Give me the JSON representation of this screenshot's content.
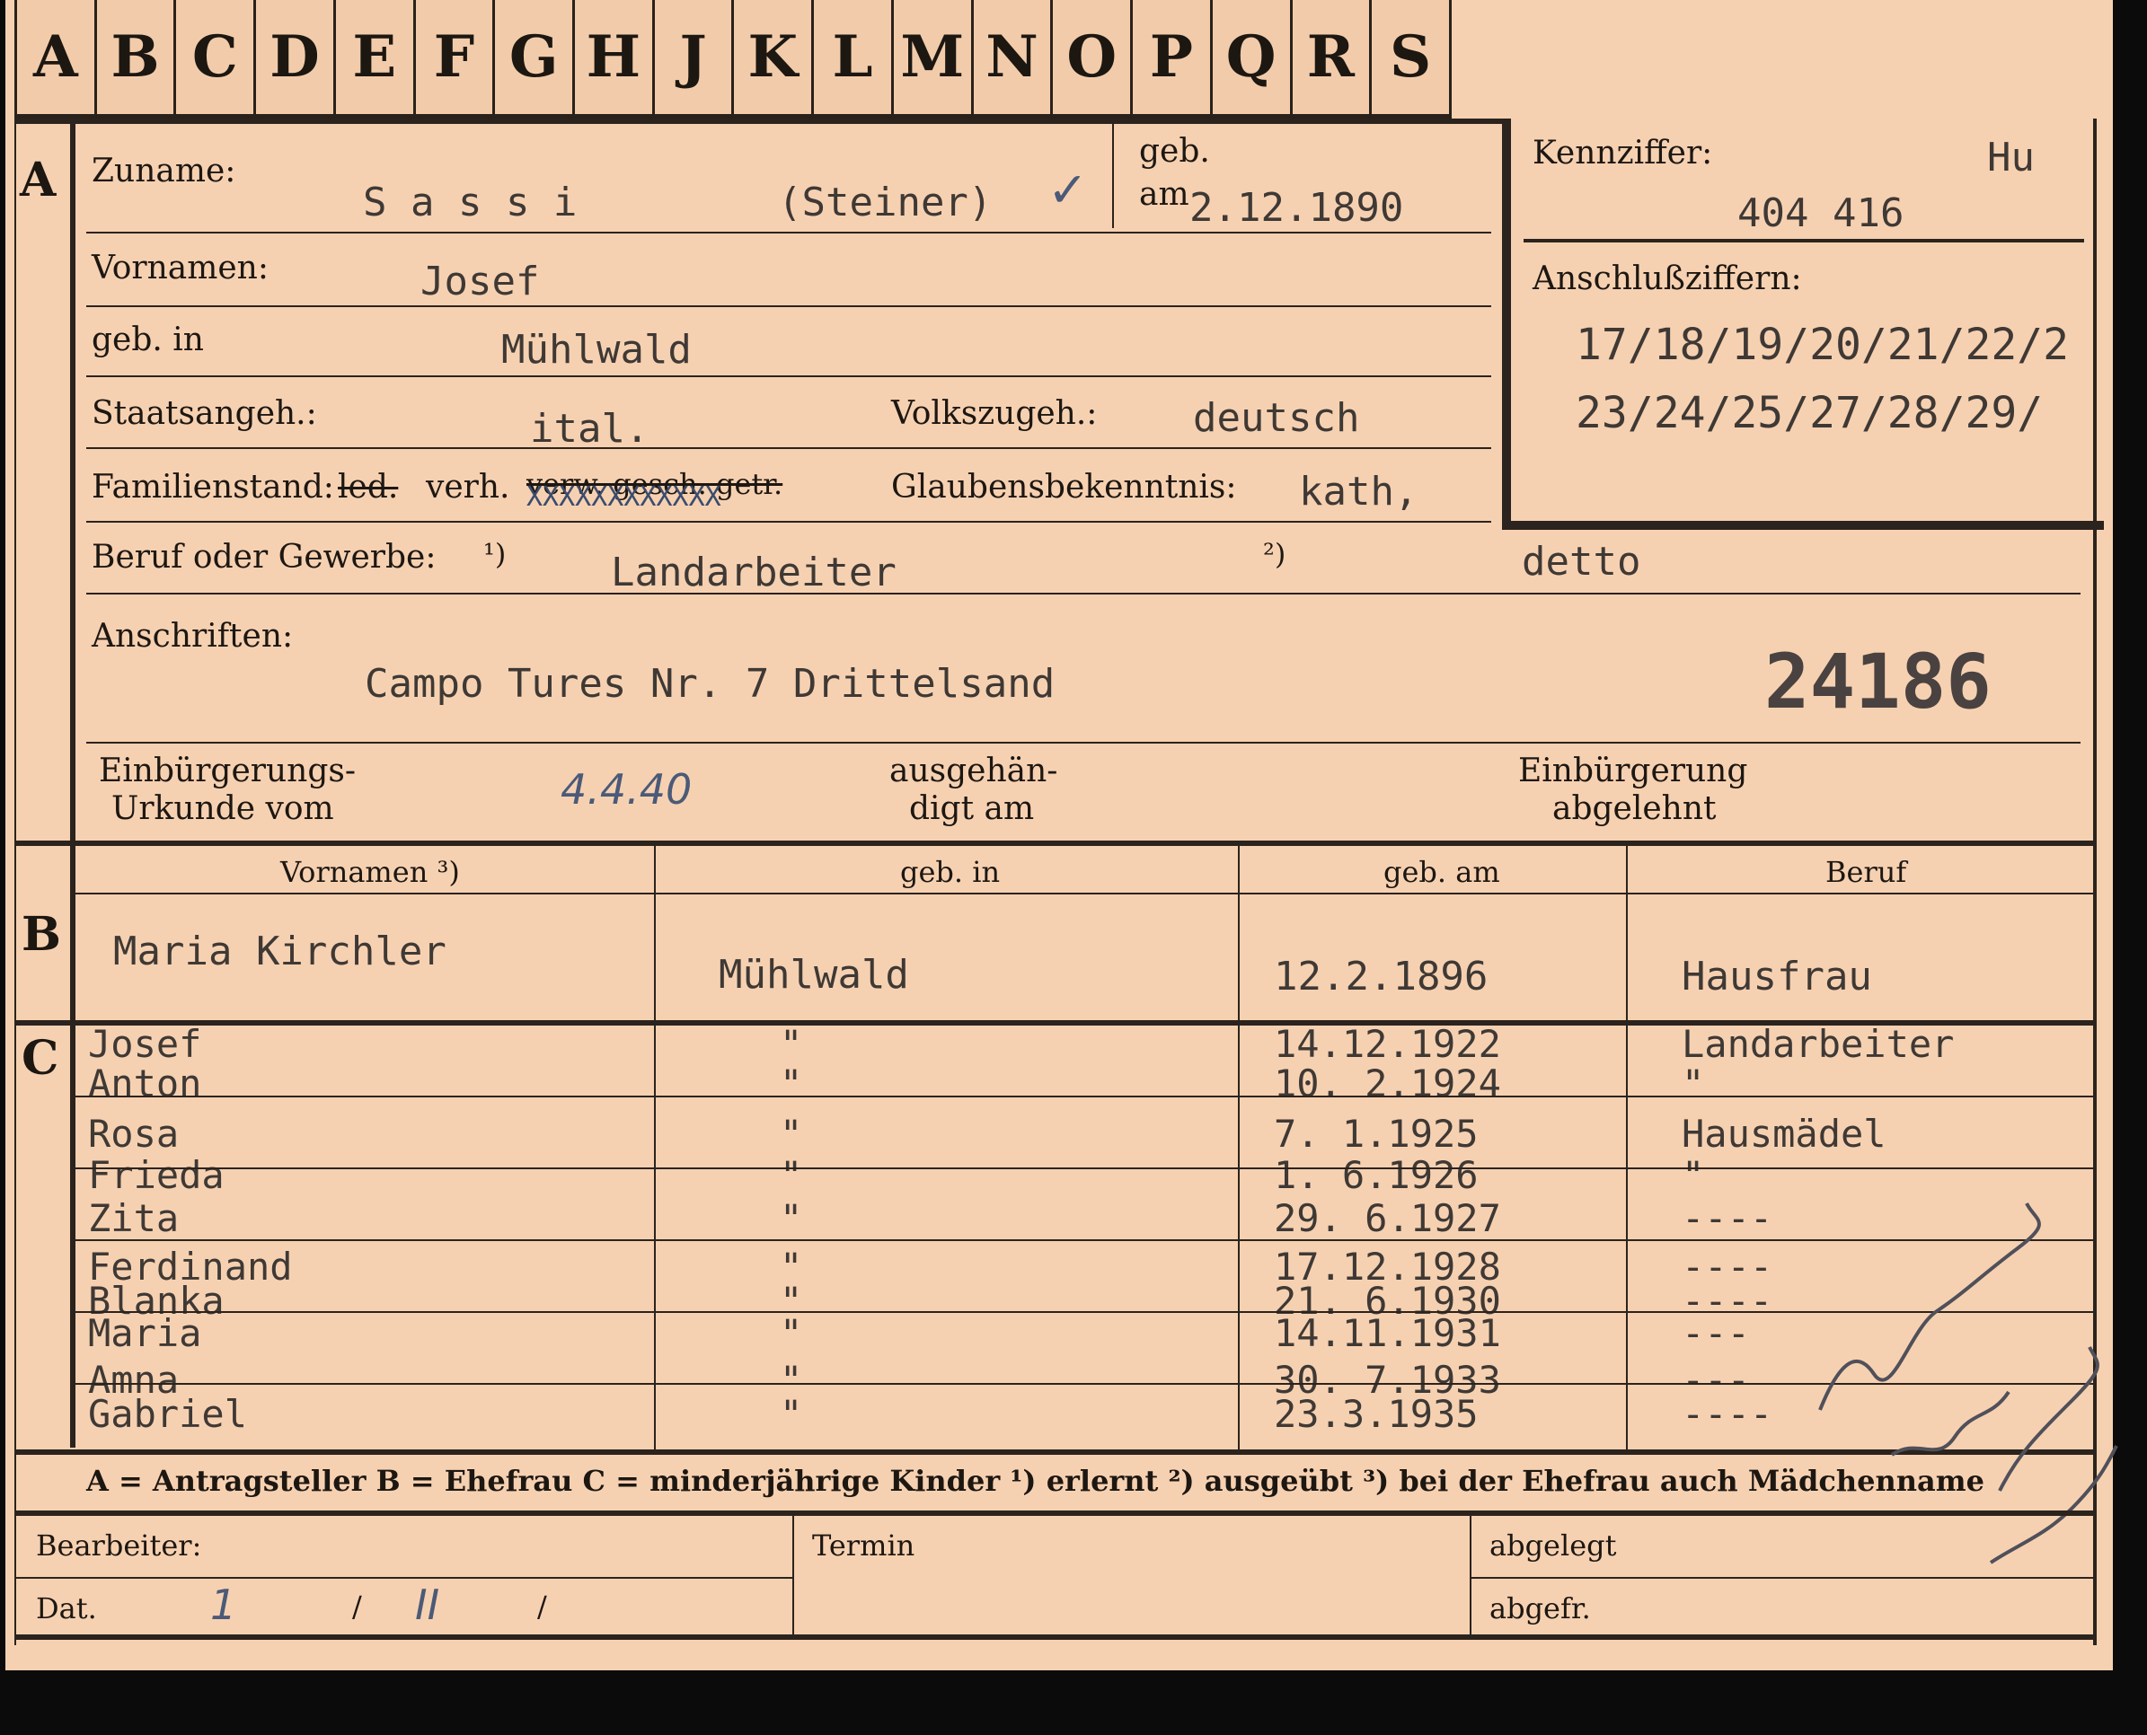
{
  "alphabet": [
    "A",
    "B",
    "C",
    "D",
    "E",
    "F",
    "G",
    "H",
    "J",
    "K",
    "L",
    "M",
    "N",
    "O",
    "P",
    "Q",
    "R",
    "S"
  ],
  "labels": {
    "sec_a": "A",
    "sec_b": "B",
    "sec_c": "C",
    "zuname": "Zuname:",
    "geb": "geb.",
    "am": "am",
    "kennziffer": "Kennziffer:",
    "anschluss": "Anschlußziffern:",
    "vornamen": "Vornamen:",
    "geb_in": "geb. in",
    "staats": "Staatsangeh.:",
    "volks": "Volkszugeh.:",
    "familien": "Familienstand:",
    "glauben": "Glaubensbekenntnis:",
    "beruf": "Beruf oder Gewerbe:",
    "sup1": "¹)",
    "sup2": "²)",
    "anschriften": "Anschriften:",
    "einb_urk_1": "Einbürgerungs-",
    "einb_urk_2": "Urkunde vom",
    "ausgeh_1": "ausgehän-",
    "ausgeh_2": "digt am",
    "einb_abg_1": "Einbürgerung",
    "einb_abg_2": "abgelehnt",
    "col_vornamen": "Vornamen ³)",
    "col_gebin": "geb. in",
    "col_gebam": "geb. am",
    "col_beruf": "Beruf",
    "legend": "A = Antragsteller   B = Ehefrau   C = minderjährige Kinder   ¹) erlernt   ²) ausgeübt   ³) bei der Ehefrau auch Mädchenname",
    "bearbeiter": "Bearbeiter:",
    "termin": "Termin",
    "abgelegt": "abgelegt",
    "dat": "Dat.",
    "abgefr": "abgefr."
  },
  "applicant": {
    "surname": "S a s s i",
    "surname_alt": "(Steiner)",
    "check_mark": "✓",
    "birth_date": "2.12.1890",
    "kennziffer_code": "Hu",
    "kennziffer": "404 416",
    "anschluss_line1": "17/18/19/20/21/22/2",
    "anschluss_line2": "23/24/25/27/28/29/",
    "first_names": "Josef",
    "birthplace": "Mühlwald",
    "citizenship": "ital.",
    "ethnicity": "deutsch",
    "family_led": "led.",
    "family_verh": "verh.",
    "family_rest": "verw. gesch. getr.",
    "family_x": "XXXXXXXXXXXX",
    "religion": "kath,",
    "occupation_learned": "Landarbeiter",
    "occupation_practiced": "detto",
    "address": "Campo Tures Nr. 7 Drittelsand",
    "file_number": "24186",
    "naturalization_date": "4.4.40"
  },
  "spouse": {
    "first_names": "Maria  Kirchler",
    "birthplace": "Mühlwald",
    "birth_date": "12.2.1896",
    "occupation": "Hausfrau"
  },
  "children": [
    {
      "name": "Josef",
      "place": "\"",
      "date": "14.12.1922",
      "occupation": "Landarbeiter"
    },
    {
      "name": "Anton",
      "place": "\"",
      "date": "10. 2.1924",
      "occupation": "\""
    },
    {
      "name": "Rosa",
      "place": "\"",
      "date": "7. 1.1925",
      "occupation": "Hausmädel"
    },
    {
      "name": "Frieda",
      "place": "\"",
      "date": "1. 6.1926",
      "occupation": "\""
    },
    {
      "name": "Zita",
      "place": "\"",
      "date": "29. 6.1927",
      "occupation": "----"
    },
    {
      "name": "Ferdinand",
      "place": "\"",
      "date": "17.12.1928",
      "occupation": "----"
    },
    {
      "name": "Blanka",
      "place": "\"",
      "date": "21. 6.1930",
      "occupation": "----"
    },
    {
      "name": "Maria",
      "place": "\"",
      "date": "14.11.1931",
      "occupation": "---"
    },
    {
      "name": "Amna",
      "place": "\"",
      "date": "30. 7.1933",
      "occupation": "---"
    },
    {
      "name": "Gabriel",
      "place": "\"",
      "date": "23.3.1935",
      "occupation": "----"
    }
  ],
  "footer": {
    "dat_1": "1",
    "dat_2": "II",
    "slash": "/"
  }
}
